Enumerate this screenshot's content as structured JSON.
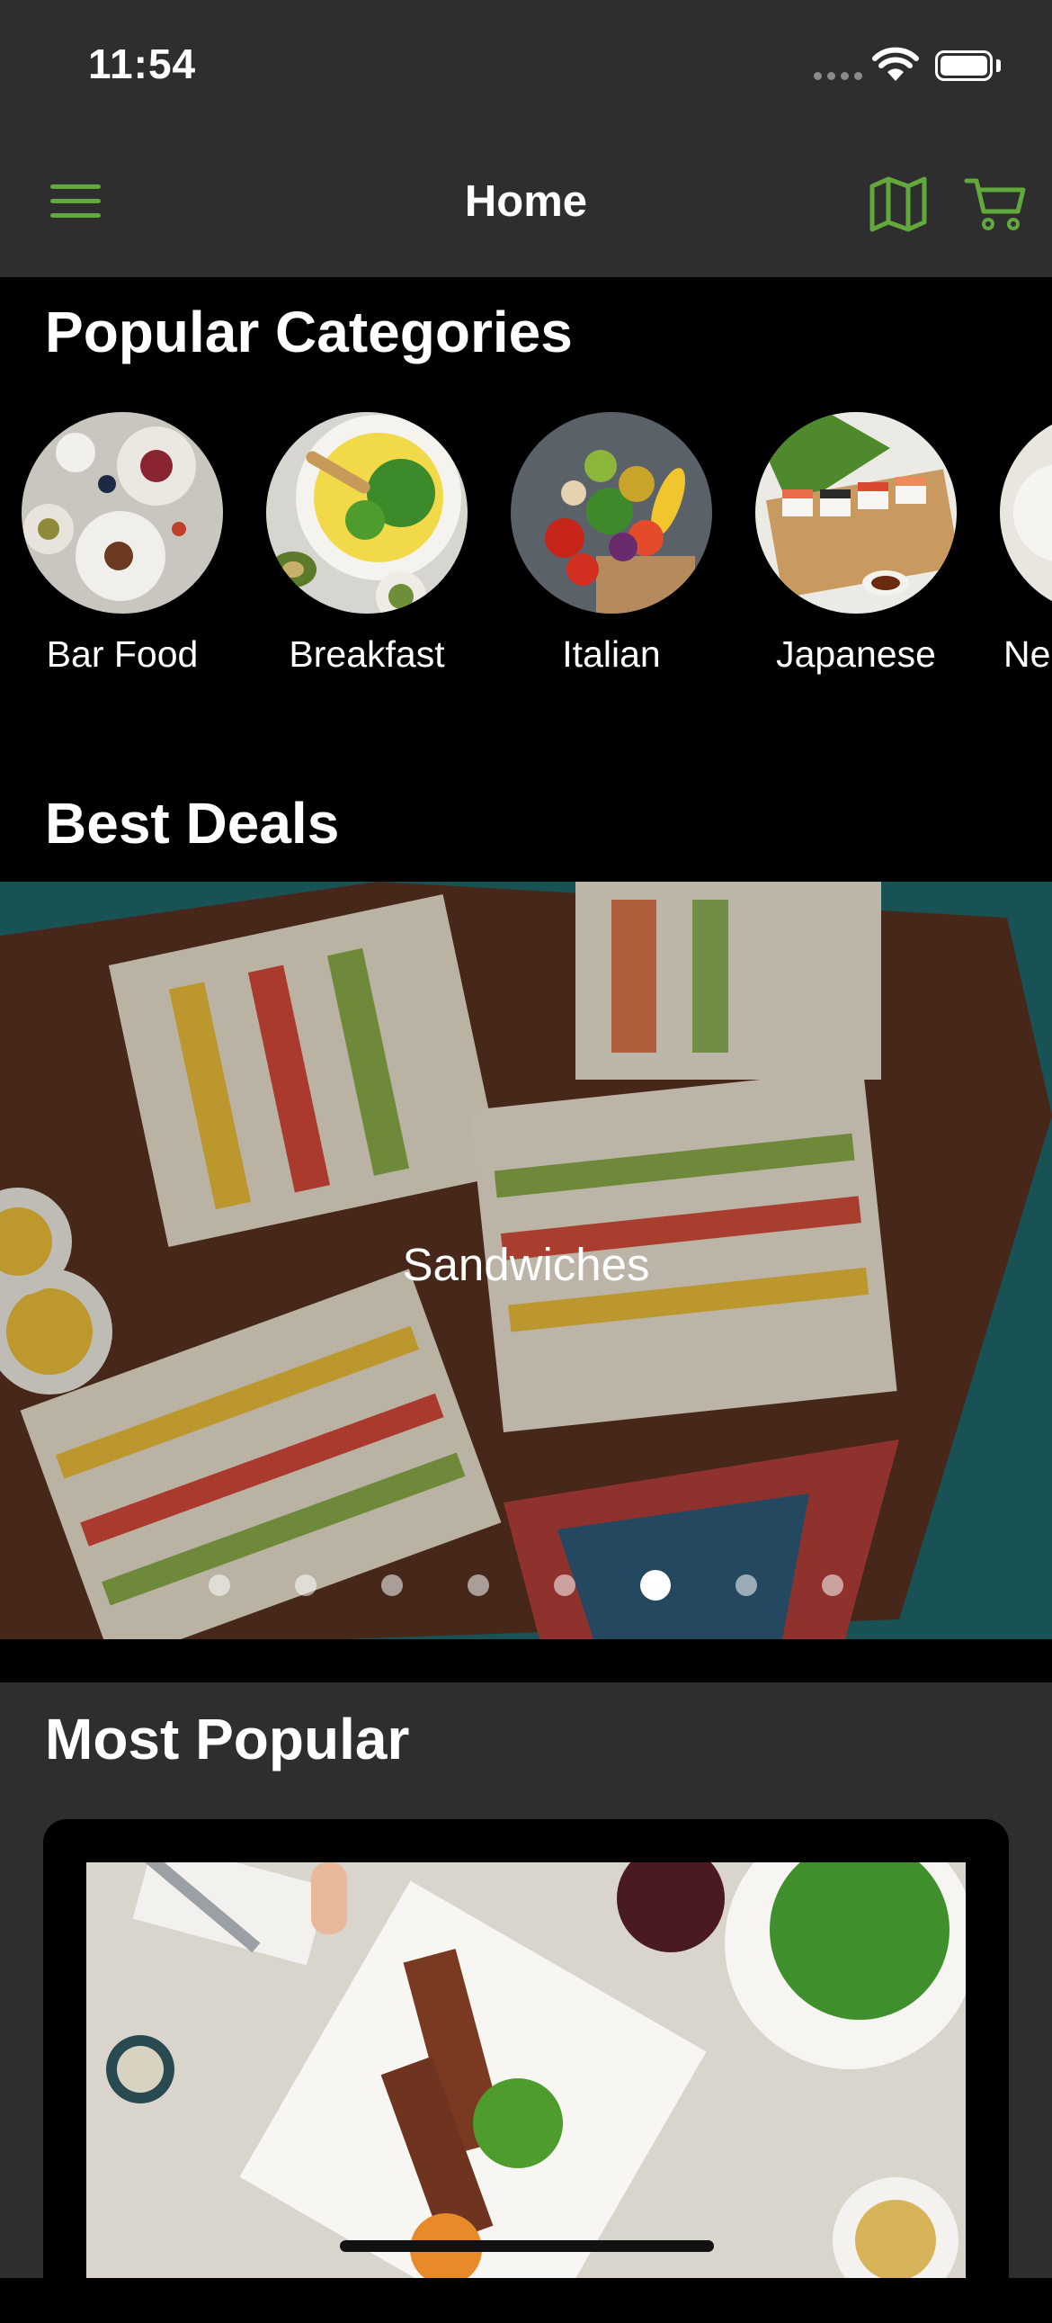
{
  "status_bar": {
    "time": "11:54"
  },
  "nav": {
    "title": "Home",
    "menu_icon": "hamburger-menu-icon",
    "map_icon": "map-icon",
    "cart_icon": "cart-icon",
    "accent_color": "#62a83c",
    "bar_color": "#2e2e2e"
  },
  "popular_categories": {
    "title": "Popular Categories",
    "items": [
      {
        "label": "Bar Food"
      },
      {
        "label": "Breakfast"
      },
      {
        "label": "Italian"
      },
      {
        "label": "Japanese"
      },
      {
        "label": "Ne"
      }
    ]
  },
  "best_deals": {
    "title": "Best Deals",
    "current_deal": "Sandwiches",
    "page_count": 8,
    "active_page": 6
  },
  "most_popular": {
    "title": "Most Popular"
  }
}
